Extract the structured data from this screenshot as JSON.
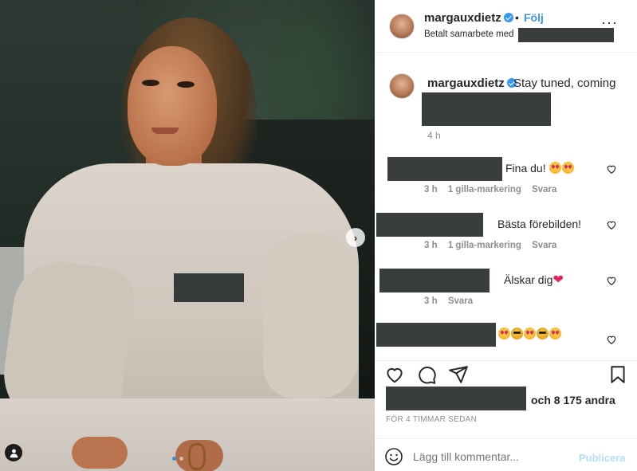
{
  "post": {
    "username": "margauxdietz",
    "follow_label": "Följ",
    "dot": "•",
    "more_label": "···",
    "sponsored_label": "Betalt samarbete med",
    "caption_text": "Stay tuned, coming",
    "caption_time": "4 h",
    "next_label": "›"
  },
  "comments": [
    {
      "text": "Fina du!",
      "emojis": 2,
      "time": "3 h",
      "likes": "1 gilla-markering",
      "reply": "Svara"
    },
    {
      "text": "Bästa förebilden!",
      "time": "3 h",
      "likes": "1 gilla-markering",
      "reply": "Svara"
    },
    {
      "text": "Älskar dig",
      "heart": "❤",
      "time": "3 h",
      "reply": "Svara"
    },
    {
      "text": "",
      "emoji_sequence": [
        "heart-eyes-emoji",
        "sunglasses-emoji",
        "heart-eyes-emoji",
        "sunglasses-emoji",
        "heart-eyes-emoji"
      ]
    }
  ],
  "likes": {
    "text": "och 8 175 andra"
  },
  "time_ago": "FÖR 4 TIMMAR SEDAN",
  "add_comment": {
    "placeholder": "Lägg till kommentar...",
    "post_label": "Publicera"
  },
  "colors": {
    "link": "#3897f0",
    "muted": "#8e8e8e",
    "redaction": "#3a3d3d",
    "post_disabled": "#b2dffc"
  },
  "icons": [
    "heart-icon",
    "comment-icon",
    "share-icon",
    "bookmark-icon",
    "smiley-icon",
    "verified-icon",
    "user-tag-icon",
    "chevron-right-icon"
  ]
}
